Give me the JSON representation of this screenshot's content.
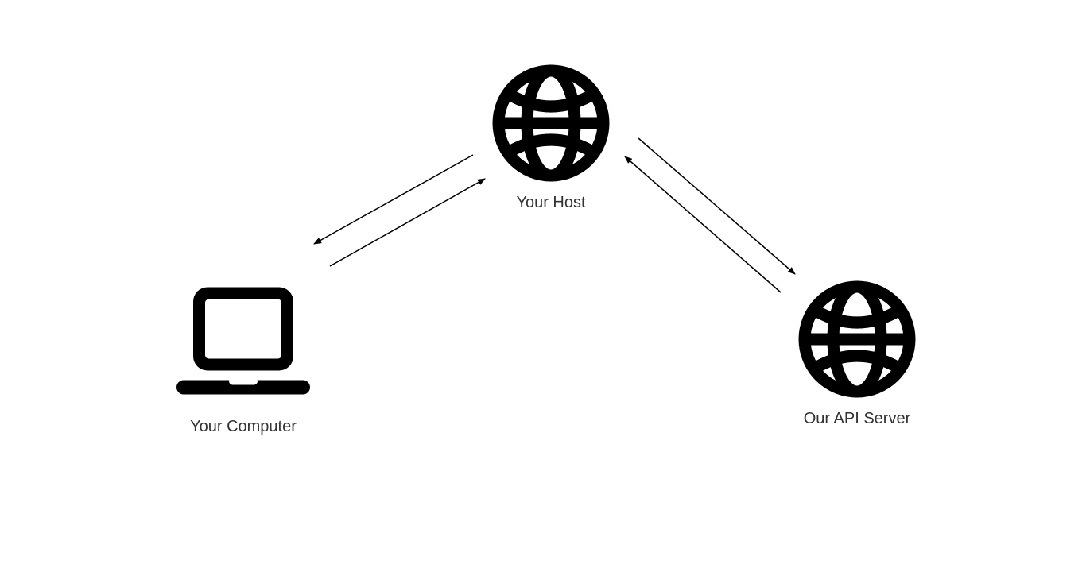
{
  "nodes": {
    "computer": {
      "label": "Your Computer"
    },
    "host": {
      "label": "Your Host"
    },
    "api": {
      "label": "Our API Server"
    }
  },
  "icons": {
    "computer": "laptop-icon",
    "host": "globe-icon",
    "api": "globe-icon"
  },
  "arrows": [
    {
      "from": "computer",
      "to": "host",
      "bidirectional": true
    },
    {
      "from": "host",
      "to": "api",
      "bidirectional": true
    }
  ],
  "colors": {
    "icon": "#000000",
    "text": "#333333",
    "arrow": "#000000",
    "background": "#ffffff"
  }
}
